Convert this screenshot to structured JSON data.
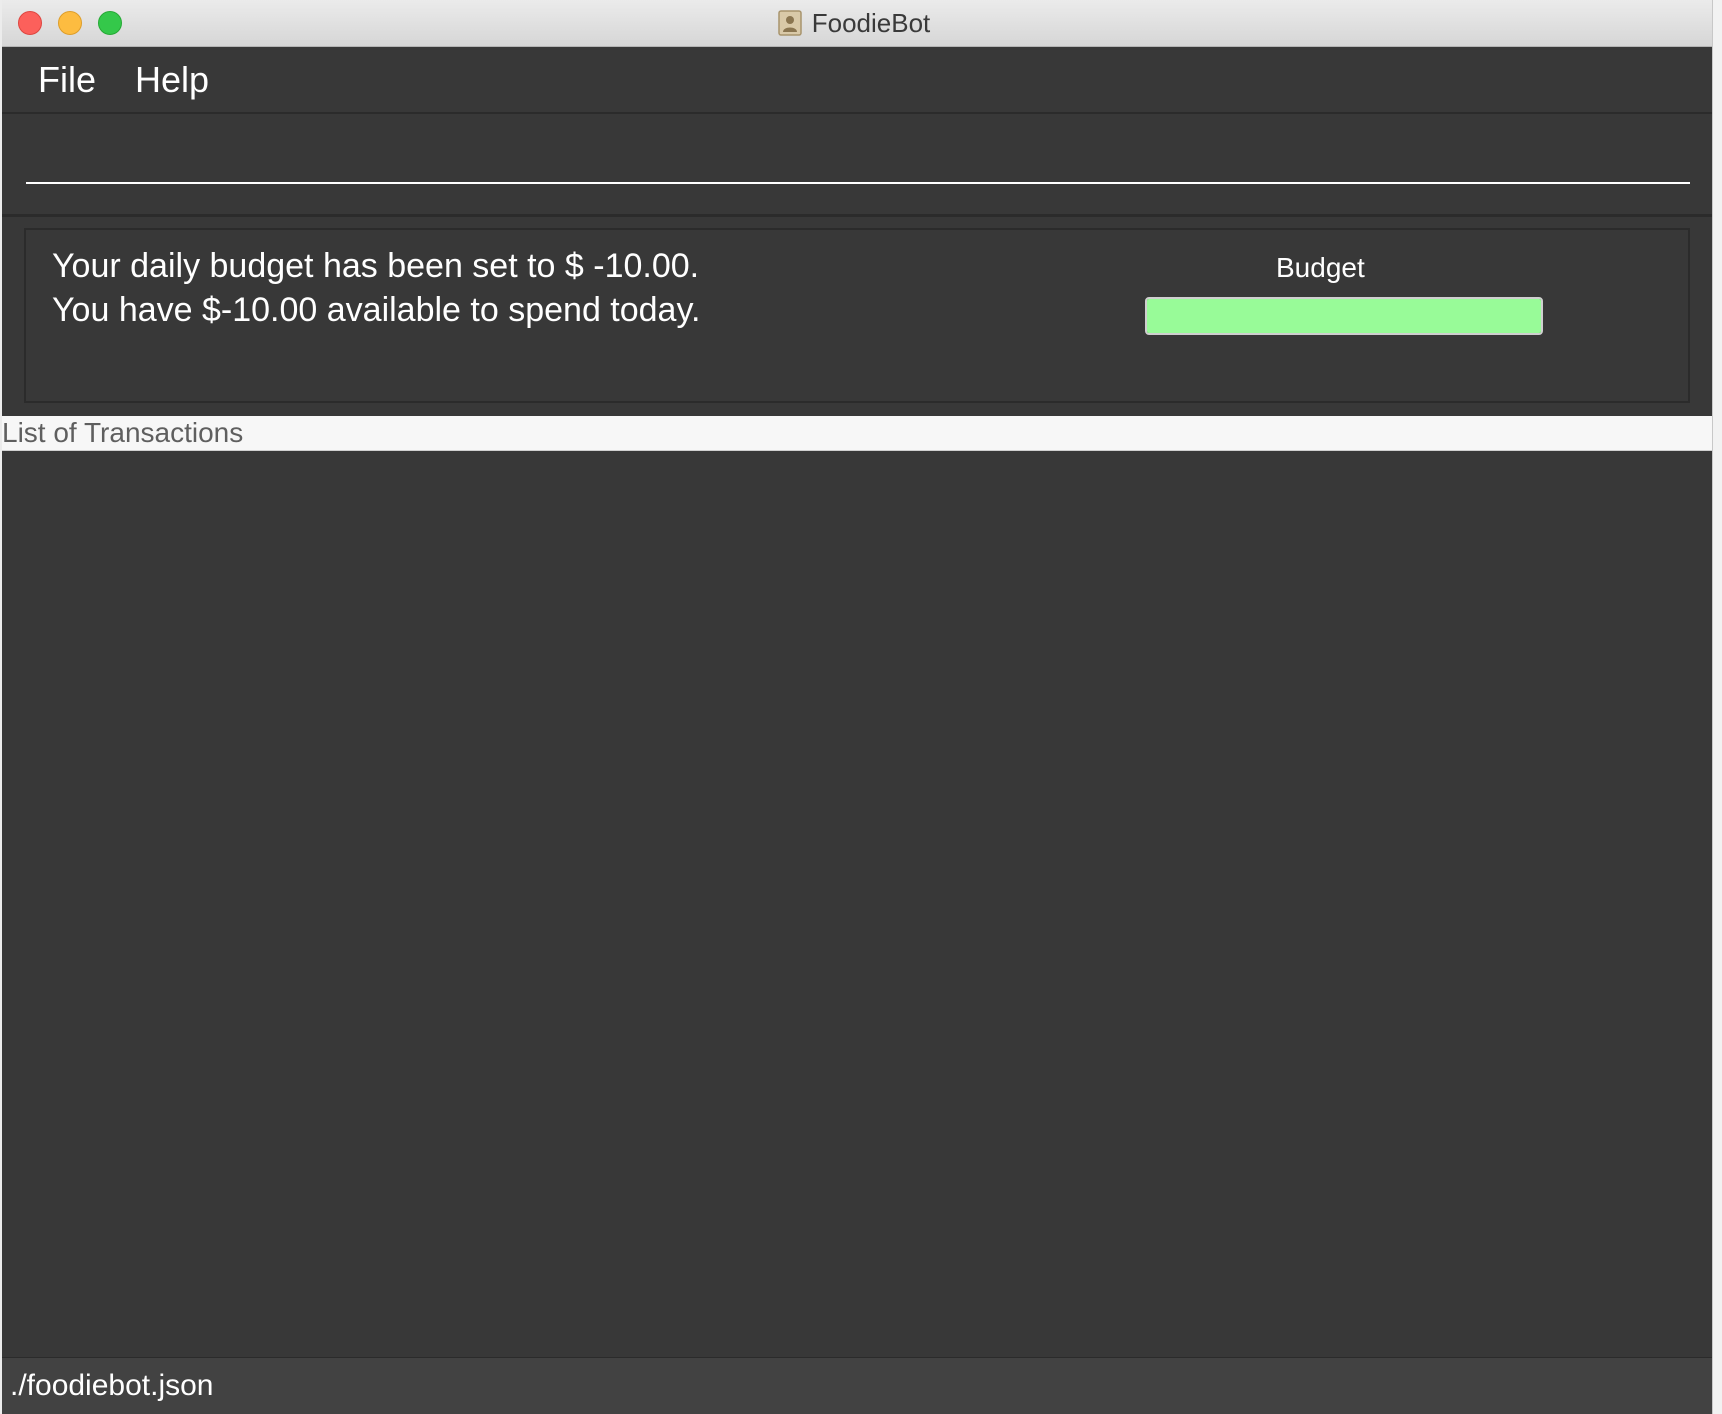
{
  "window": {
    "title": "FoodieBot"
  },
  "menu": {
    "items": [
      {
        "label": "File"
      },
      {
        "label": "Help"
      }
    ]
  },
  "command_box": {
    "value": "",
    "placeholder": ""
  },
  "result": {
    "line1": "Your daily budget has been set to $ -10.00.",
    "line2": "You have $-10.00 available to spend today."
  },
  "budget": {
    "label": "Budget",
    "progress": 1.0,
    "fill_color": "#98fb98"
  },
  "transactions": {
    "header": "List of Transactions",
    "items": []
  },
  "status_bar": {
    "path": "./foodiebot.json"
  },
  "colors": {
    "background": "#383838",
    "header_bg": "#f7f7f7"
  }
}
